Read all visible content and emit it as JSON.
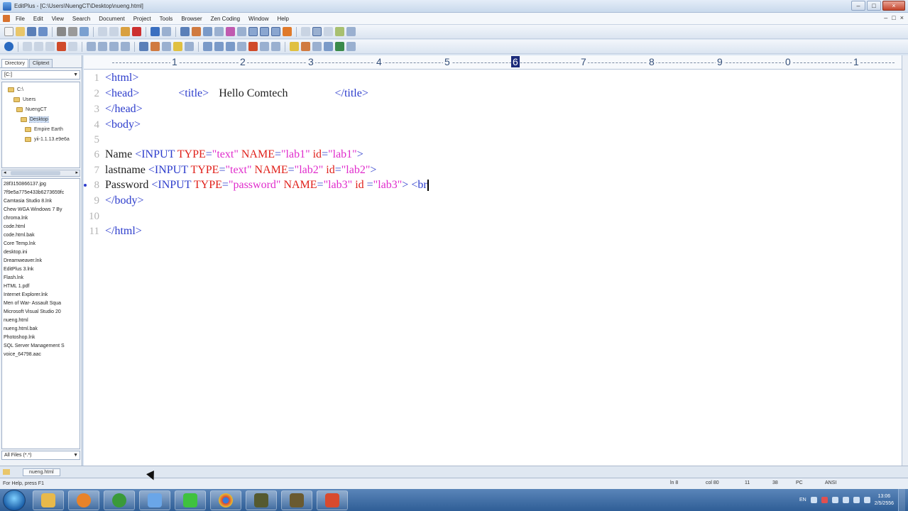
{
  "window": {
    "title": "EditPlus - [C:\\Users\\NuengCT\\Desktop\\nueng.html]",
    "controls": [
      "–",
      "□",
      "×"
    ]
  },
  "menubar": {
    "items": [
      "File",
      "Edit",
      "View",
      "Search",
      "Document",
      "Project",
      "Tools",
      "Browser",
      "Zen Coding",
      "Window",
      "Help"
    ],
    "mdi_controls": [
      "–",
      "□",
      "×"
    ]
  },
  "left_panel": {
    "tabs": [
      "Directory",
      "Cliptext"
    ],
    "drive": "[C:]",
    "folders": [
      "C:\\",
      "Users",
      "NuengCT",
      "Desktop",
      "Empire Earth",
      "yii-1.1.13.e9e6a"
    ],
    "files": [
      "28f3150866137.jpg",
      "7f9e5a775e433b6273659fc",
      "Camtasia Studio 8.lnk",
      "Chew WGA Windows 7 By",
      "chroma.lnk",
      "code.html",
      "code.html.bak",
      "Core Temp.lnk",
      "desktop.ini",
      "Dreamweaver.lnk",
      "EditPlus 3.lnk",
      "Flash.lnk",
      "HTML 1.pdf",
      "Internet Explorer.lnk",
      "Men of War- Assault Squa",
      "Microsoft Visual Studio 20",
      "nueng.html",
      "nueng.html.bak",
      "Photoshop.lnk",
      "SQL Server Management S",
      "voice_64798.aac"
    ],
    "filter": "All Files (*.*)"
  },
  "ruler": {
    "marks": [
      "1",
      "2",
      "3",
      "4",
      "5",
      "6",
      "7",
      "8",
      "9",
      "0",
      "1"
    ],
    "active": "6"
  },
  "editor": {
    "line_numbers": [
      "1",
      "2",
      "3",
      "4",
      "5",
      "6",
      "7",
      "8",
      "9",
      "10",
      "11"
    ],
    "l1": {
      "html_open": "<html>"
    },
    "l2": {
      "head_open": "<head>",
      "title_open": "<title>",
      "title_text": "Hello Comtech",
      "title_close": "</title>"
    },
    "l3": {
      "head_close": "</head>"
    },
    "l4": {
      "body_open": "<body>"
    },
    "l6": {
      "label": "Name ",
      "tag_open": "<INPUT ",
      "type_attr": "TYPE",
      "eq1": "=",
      "type_val": "\"text\"",
      "name_attr": " NAME",
      "eq2": "=",
      "name_val": "\"lab1\"",
      "id_attr": " id",
      "eq3": "=",
      "id_val": "\"lab1\"",
      "tag_close": ">"
    },
    "l7": {
      "label": "lastname ",
      "tag_open": "<INPUT ",
      "type_attr": "TYPE",
      "eq1": "=",
      "type_val": "\"text\"",
      "name_attr": " NAME",
      "eq2": "=",
      "name_val": "\"lab2\"",
      "id_attr": " id",
      "eq3": "=",
      "id_val": "\"lab2\"",
      "tag_close": ">"
    },
    "l8": {
      "label": "Password ",
      "tag_open": "<INPUT ",
      "type_attr": "TYPE",
      "eq1": "=",
      "type_val": "\"password\"",
      "name_attr": " NAME",
      "eq2": "=",
      "name_val": "\"lab3\"",
      "id_attr": " id ",
      "eq3": "=",
      "id_val": "\"lab3\"",
      "tag_close": "> ",
      "partial": "<br"
    },
    "l9": {
      "body_close": "</body>"
    },
    "l11": {
      "html_close": "</html>"
    }
  },
  "doc_tabs": {
    "active": "nueng.html"
  },
  "statusbar": {
    "help": "For Help, press F1",
    "ln": "ln 8",
    "col": "col 80",
    "f1": "11",
    "f2": "38",
    "f3": "PC",
    "encoding": "ANSI"
  },
  "taskbar": {
    "tray_lang": "EN",
    "clock_time": "13:06",
    "clock_date": "2/5/2556",
    "apps": [
      "explorer",
      "media-player",
      "utorrent",
      "network",
      "line",
      "chrome",
      "game",
      "game2",
      "editplus"
    ],
    "app_colors": [
      "#e8b94a",
      "#e8832a",
      "#3a9a3a",
      "#6aa6e8",
      "#3fc23f",
      "#dd4433",
      "#555a30",
      "#6a5a30",
      "#d84a2e"
    ]
  },
  "colors": {
    "tag": "#2c3ccc",
    "attr": "#e0201a",
    "value": "#e02ccc",
    "text": "#222222",
    "line_number": "#b3b3b3"
  }
}
